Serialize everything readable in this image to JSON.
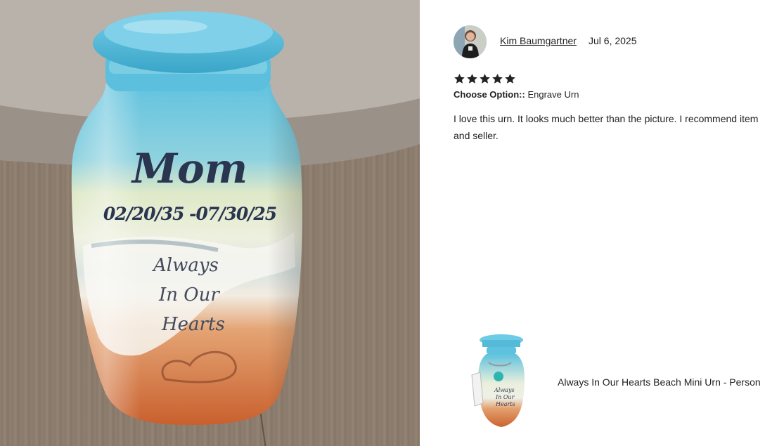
{
  "photo": {
    "urn_name": "Mom",
    "urn_dates": "02/20/35 -07/30/25",
    "urn_line1": "Always",
    "urn_line2": "In Our",
    "urn_line3": "Hearts"
  },
  "review": {
    "reviewer_name": "Kim Baumgartner",
    "date": "Jul 6, 2025",
    "rating": 5,
    "option_label": "Choose Option::",
    "option_value": "Engrave Urn",
    "text": "I love this urn. It looks much better than the picture. I recommend item and seller."
  },
  "product": {
    "title": "Always In Our Hearts Beach Mini Urn - Person"
  },
  "colors": {
    "urn_blue": "#5bbfdc",
    "urn_orange": "#d9703c",
    "text_dark": "#222222",
    "engrave": "#2a3550"
  }
}
